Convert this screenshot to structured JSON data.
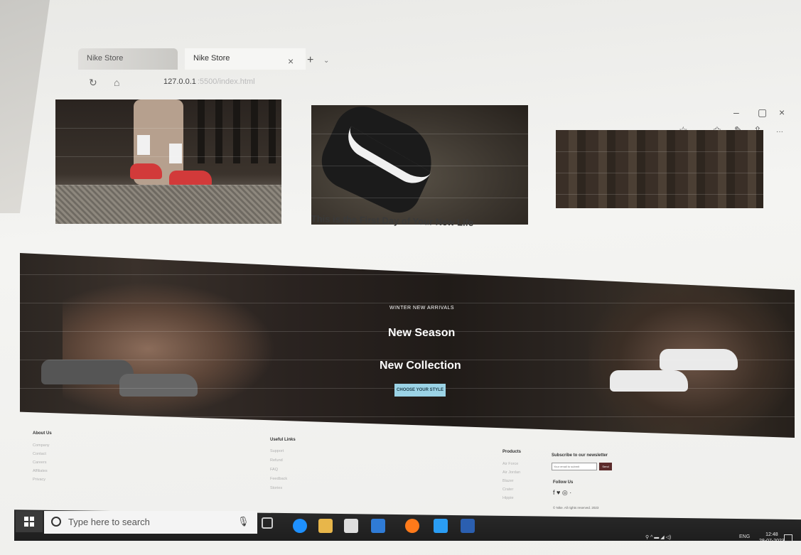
{
  "browser": {
    "tabs": [
      {
        "label": "Nike Store"
      },
      {
        "label": "Nike Store"
      }
    ],
    "close_tab": "×",
    "new_tab": "+",
    "tab_menu": "⌄",
    "address": "127.0.0.1",
    "address_rest": ":5500/index.html",
    "window_controls": {
      "minimize": "–",
      "maximize": "▢",
      "close": "×"
    },
    "toolbar_icons": {
      "star": "☆",
      "favorites": "✩",
      "pen": "✎",
      "share": "⇪",
      "more": "···"
    },
    "nav_icons": {
      "refresh": "↻",
      "home": "⌂"
    }
  },
  "gallery": {
    "caption": "This is the First Day of Your New Life"
  },
  "banner": {
    "kicker": "WINTER NEW ARRIVALS",
    "title1": "New Season",
    "title2": "New Collection",
    "button": "CHOOSE YOUR STYLE"
  },
  "footer": {
    "about": {
      "heading": "About Us",
      "links": [
        "Company",
        "Contact",
        "Careers",
        "Affiliates",
        "Privacy"
      ]
    },
    "useful": {
      "heading": "Useful Links",
      "links": [
        "Support",
        "Refund",
        "FAQ",
        "Feedback",
        "Stories"
      ]
    },
    "products": {
      "heading": "Products",
      "links": [
        "Air Force",
        "Air Jordan",
        "Blazer",
        "Crater",
        "Hippie"
      ]
    },
    "newsletter": {
      "heading": "Subscribe to our newsletter",
      "placeholder": "Your email to submit",
      "button": "Send"
    },
    "follow": {
      "heading": "Follow Us",
      "icons": "f ♥ ◎ ·"
    },
    "copyright": "© Nike. All rights reserved. 2023"
  },
  "taskbar": {
    "search_placeholder": "Type here to search",
    "mic": "🎙",
    "language": "ENG",
    "time": "12:48",
    "date": "28-07-2023",
    "tray_icons": "⚲ ^ ▬ ◢ ◁) "
  },
  "colors": {
    "cta": "#9bd3e6",
    "send_button": "#5b2b2b",
    "taskbar": "#1e1e1e"
  }
}
